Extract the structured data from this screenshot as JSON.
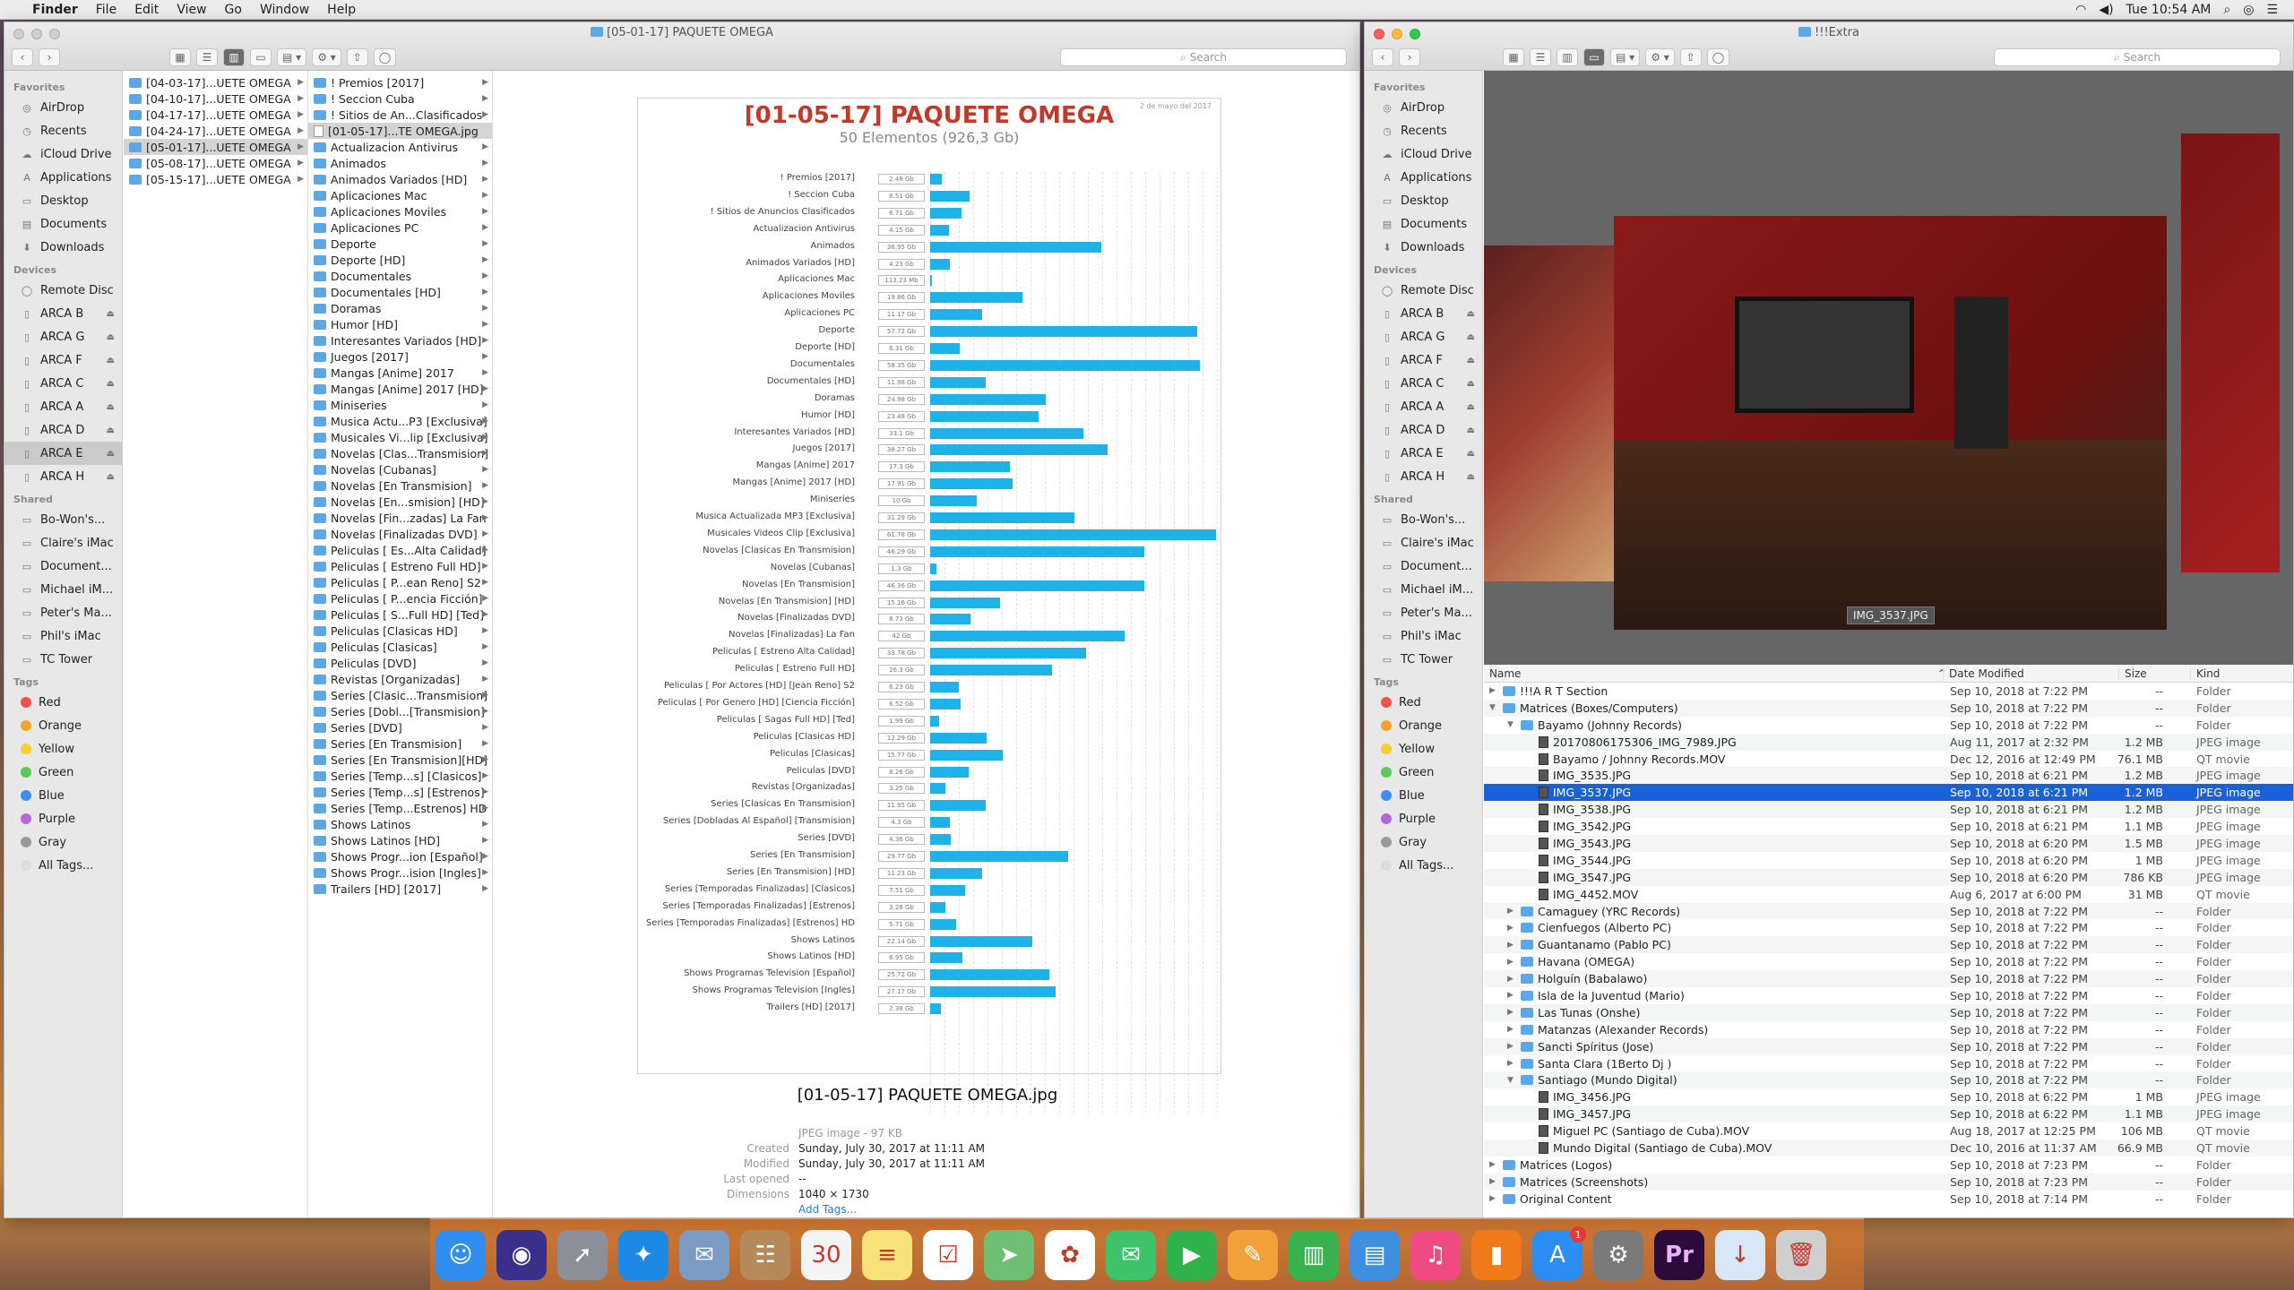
{
  "menubar": {
    "app": "Finder",
    "items": [
      "File",
      "Edit",
      "View",
      "Go",
      "Window",
      "Help"
    ],
    "clock": "Tue 10:54 AM"
  },
  "left_window": {
    "title": "[05-01-17] PAQUETE OMEGA",
    "search_placeholder": "Search",
    "sidebar": {
      "favorites_header": "Favorites",
      "favorites": [
        "AirDrop",
        "Recents",
        "iCloud Drive",
        "Applications",
        "Desktop",
        "Documents",
        "Downloads"
      ],
      "devices_header": "Devices",
      "devices": [
        "Remote Disc",
        "ARCA B",
        "ARCA G",
        "ARCA F",
        "ARCA C",
        "ARCA A",
        "ARCA D",
        "ARCA E",
        "ARCA H"
      ],
      "shared_header": "Shared",
      "shared": [
        "Bo-Won's...",
        "Claire's iMac",
        "Document...",
        "Michael iM...",
        "Peter's Ma...",
        "Phil's iMac",
        "TC Tower"
      ],
      "tags_header": "Tags",
      "tags": [
        {
          "name": "Red",
          "color": "#f4504a"
        },
        {
          "name": "Orange",
          "color": "#f6a32c"
        },
        {
          "name": "Yellow",
          "color": "#f6d02e"
        },
        {
          "name": "Green",
          "color": "#5ac85a"
        },
        {
          "name": "Blue",
          "color": "#3d8ef0"
        },
        {
          "name": "Purple",
          "color": "#b36ad8"
        },
        {
          "name": "Gray",
          "color": "#9a9a9a"
        },
        {
          "name": "All Tags...",
          "color": "#dddddd"
        }
      ]
    },
    "column1": [
      "[04-03-17]...UETE OMEGA",
      "[04-10-17]...UETE OMEGA",
      "[04-17-17]...UETE OMEGA",
      "[04-24-17]...UETE OMEGA",
      "[05-01-17]...UETE OMEGA",
      "[05-08-17]...UETE OMEGA",
      "[05-15-17]...UETE OMEGA"
    ],
    "column2": [
      "! Premios [2017]",
      "! Seccion Cuba",
      "! Sitios de An...Clasificados",
      "[01-05-17]...TE OMEGA.jpg",
      "Actualizacion Antivirus",
      "Animados",
      "Animados Variados [HD]",
      "Aplicaciones Mac",
      "Aplicaciones Moviles",
      "Aplicaciones PC",
      "Deporte",
      "Deporte [HD]",
      "Documentales",
      "Documentales [HD]",
      "Doramas",
      "Humor [HD]",
      "Interesantes Variados [HD]",
      "Juegos [2017]",
      "Mangas [Anime] 2017",
      "Mangas [Anime] 2017 [HD]",
      "Miniseries",
      "Musica Actu...P3 [Exclusiva]",
      "Musicales Vi...lip [Exclusiva]",
      "Novelas [Clas...Transmision]",
      "Novelas [Cubanas]",
      "Novelas [En Transmision]",
      "Novelas [En...smision] [HD]",
      "Novelas [Fin...zadas] La Fan",
      "Novelas [Finalizadas DVD]",
      "Peliculas [ Es...Alta Calidad]",
      "Peliculas [ Estreno Full HD]",
      "Peliculas [ P...ean Reno] S2",
      "Peliculas [ P...encia Ficción]",
      "Peliculas [ S...Full HD] [Ted]",
      "Peliculas [Clasicas HD]",
      "Peliculas [Clasicas]",
      "Peliculas [DVD]",
      "Revistas [Organizadas]",
      "Series [Clasic...Transmision]",
      "Series [Dobl...[Transmision]",
      "Series [DVD]",
      "Series [En Transmision]",
      "Series [En Transmision][HD]",
      "Series [Temp...s] [Clasicos]",
      "Series [Temp...s] [Estrenos]",
      "Series [Temp...Estrenos] HD",
      "Shows Latinos",
      "Shows Latinos [HD]",
      "Shows Progr...ion [Español]",
      "Shows Progr...ision [Ingles]",
      "Trailers [HD] [2017]"
    ],
    "column2_selected": 3,
    "preview": {
      "chart_title": "[01-05-17] PAQUETE OMEGA",
      "chart_subtitle": "50 Elementos (926,3 Gb)",
      "chart_date": "2 de mayo del 2017",
      "file_name": "[01-05-17] PAQUETE OMEGA.jpg",
      "kind": "JPEG image - 97 KB",
      "created_label": "Created",
      "created": "Sunday, July 30, 2017 at 11:11 AM",
      "modified_label": "Modified",
      "modified": "Sunday, July 30, 2017 at 11:11 AM",
      "opened_label": "Last opened",
      "opened": "--",
      "dim_label": "Dimensions",
      "dimensions": "1040 × 1730",
      "add_tags": "Add Tags..."
    }
  },
  "chart_data": {
    "type": "bar",
    "title": "[01-05-17] PAQUETE OMEGA",
    "subtitle": "50 Elementos (926,3 Gb)",
    "categories": [
      "! Premios [2017]",
      "! Seccion Cuba",
      "! Sitios de Anuncios Clasificados",
      "Actualizacion Antivirus",
      "Animados",
      "Animados Variados [HD]",
      "Aplicaciones Mac",
      "Aplicaciones Moviles",
      "Aplicaciones PC",
      "Deporte",
      "Deporte [HD]",
      "Documentales",
      "Documentales [HD]",
      "Doramas",
      "Humor [HD]",
      "Interesantes Variados [HD]",
      "Juegos [2017]",
      "Mangas [Anime] 2017",
      "Mangas [Anime] 2017 [HD]",
      "Miniseries",
      "Musica Actualizada MP3 [Exclusiva]",
      "Musicales Videos Clip [Exclusiva]",
      "Novelas [Clasicas En Transmision]",
      "Novelas [Cubanas]",
      "Novelas [En Transmision]",
      "Novelas [En Transmision] [HD]",
      "Novelas [Finalizadas DVD]",
      "Novelas [Finalizadas] La Fan",
      "Peliculas [ Estreno Alta Calidad]",
      "Peliculas [ Estreno Full HD]",
      "Peliculas [ Por Actores [HD] [Jean Reno] S2",
      "Peliculas [ Por Genero [HD] [Ciencia Ficción]",
      "Peliculas [ Sagas Full HD] [Ted]",
      "Peliculas [Clasicas HD]",
      "Peliculas [Clasicas]",
      "Peliculas [DVD]",
      "Revistas [Organizadas]",
      "Series [Clasicas En Transmision]",
      "Series [Dobladas Al Español] [Transmision]",
      "Series [DVD]",
      "Series [En Transmision]",
      "Series [En Transmision] [HD]",
      "Series [Temporadas Finalizadas] [Clasicos]",
      "Series [Temporadas Finalizadas] [Estrenos]",
      "Series [Temporadas Finalizadas] [Estrenos] HD",
      "Shows Latinos",
      "Shows Latinos [HD]",
      "Shows Programas Television [Español]",
      "Shows Programas Television [Ingles]",
      "Trailers [HD] [2017]"
    ],
    "values": [
      2.48,
      8.51,
      6.71,
      4.15,
      36.95,
      4.23,
      0.113,
      19.86,
      11.17,
      57.72,
      6.31,
      58.35,
      11.98,
      24.98,
      23.48,
      33.1,
      38.27,
      17.3,
      17.91,
      10,
      31.29,
      61.78,
      46.29,
      1.3,
      46.36,
      15.16,
      8.73,
      42,
      33.78,
      26.3,
      6.23,
      6.52,
      1.99,
      12.29,
      15.77,
      8.26,
      3.25,
      11.95,
      4.3,
      4.36,
      29.77,
      11.23,
      7.51,
      3.28,
      5.71,
      22.14,
      6.95,
      25.72,
      27.17,
      2.38
    ],
    "value_labels": [
      "2.48 Gb",
      "8.51 Gb",
      "6.71 Gb",
      "4.15 Gb",
      "36.95 Gb",
      "4.23 Gb",
      "113.23 Mb",
      "19.86 Gb",
      "11.17 Gb",
      "57.72 Gb",
      "6.31 Gb",
      "58.35 Gb",
      "11.98 Gb",
      "24.98 Gb",
      "23.48 Gb",
      "33.1 Gb",
      "38.27 Gb",
      "17.3 Gb",
      "17.91 Gb",
      "10 Gb",
      "31.29 Gb",
      "61.78 Gb",
      "46.29 Gb",
      "1.3 Gb",
      "46.36 Gb",
      "15.16 Gb",
      "8.73 Gb",
      "42 Gb",
      "33.78 Gb",
      "26.3 Gb",
      "6.23 Gb",
      "6.52 Gb",
      "1.99 Gb",
      "12.29 Gb",
      "15.77 Gb",
      "8.26 Gb",
      "3.25 Gb",
      "11.95 Gb",
      "4.3 Gb",
      "4.36 Gb",
      "29.77 Gb",
      "11.23 Gb",
      "7.51 Gb",
      "3.28 Gb",
      "5.71 Gb",
      "22.14 Gb",
      "6.95 Gb",
      "25.72 Gb",
      "27.17 Gb",
      "2.38 Gb"
    ],
    "xlim": [
      0,
      62
    ],
    "bar_color": "#1eb2e8",
    "grid": true
  },
  "right_window": {
    "title": "!!!Extra",
    "search_placeholder": "Search",
    "caption": "IMG_3537.JPG",
    "columns": {
      "name": "Name",
      "date": "Date Modified",
      "size": "Size",
      "kind": "Kind"
    },
    "rows": [
      {
        "indent": 0,
        "disc": "▶",
        "type": "folder",
        "name": "!!!A R T Section",
        "date": "Sep 10, 2018 at 7:22 PM",
        "size": "--",
        "kind": "Folder"
      },
      {
        "indent": 0,
        "disc": "▼",
        "type": "folder",
        "name": "Matrices (Boxes/Computers)",
        "date": "Sep 10, 2018 at 7:22 PM",
        "size": "--",
        "kind": "Folder"
      },
      {
        "indent": 1,
        "disc": "▼",
        "type": "folder",
        "name": "Bayamo (Johnny Records)",
        "date": "Sep 10, 2018 at 7:22 PM",
        "size": "--",
        "kind": "Folder"
      },
      {
        "indent": 2,
        "disc": "",
        "type": "file",
        "name": "20170806175306_IMG_7989.JPG",
        "date": "Aug 11, 2017 at 2:32 PM",
        "size": "1.2 MB",
        "kind": "JPEG image"
      },
      {
        "indent": 2,
        "disc": "",
        "type": "file",
        "name": "Bayamo / Johnny Records.MOV",
        "date": "Dec 12, 2016 at 12:49 PM",
        "size": "76.1 MB",
        "kind": "QT movie"
      },
      {
        "indent": 2,
        "disc": "",
        "type": "file",
        "name": "IMG_3535.JPG",
        "date": "Sep 10, 2018 at 6:21 PM",
        "size": "1.2 MB",
        "kind": "JPEG image"
      },
      {
        "indent": 2,
        "disc": "",
        "type": "file",
        "name": "IMG_3537.JPG",
        "date": "Sep 10, 2018 at 6:21 PM",
        "size": "1.2 MB",
        "kind": "JPEG image",
        "selected": true
      },
      {
        "indent": 2,
        "disc": "",
        "type": "file",
        "name": "IMG_3538.JPG",
        "date": "Sep 10, 2018 at 6:21 PM",
        "size": "1.2 MB",
        "kind": "JPEG image"
      },
      {
        "indent": 2,
        "disc": "",
        "type": "file",
        "name": "IMG_3542.JPG",
        "date": "Sep 10, 2018 at 6:21 PM",
        "size": "1.1 MB",
        "kind": "JPEG image"
      },
      {
        "indent": 2,
        "disc": "",
        "type": "file",
        "name": "IMG_3543.JPG",
        "date": "Sep 10, 2018 at 6:20 PM",
        "size": "1.5 MB",
        "kind": "JPEG image"
      },
      {
        "indent": 2,
        "disc": "",
        "type": "file",
        "name": "IMG_3544.JPG",
        "date": "Sep 10, 2018 at 6:20 PM",
        "size": "1 MB",
        "kind": "JPEG image"
      },
      {
        "indent": 2,
        "disc": "",
        "type": "file",
        "name": "IMG_3547.JPG",
        "date": "Sep 10, 2018 at 6:20 PM",
        "size": "786 KB",
        "kind": "JPEG image"
      },
      {
        "indent": 2,
        "disc": "",
        "type": "file",
        "name": "IMG_4452.MOV",
        "date": "Aug 6, 2017 at 6:00 PM",
        "size": "31 MB",
        "kind": "QT movie"
      },
      {
        "indent": 1,
        "disc": "▶",
        "type": "folder",
        "name": "Camaguey (YRC Records)",
        "date": "Sep 10, 2018 at 7:22 PM",
        "size": "--",
        "kind": "Folder"
      },
      {
        "indent": 1,
        "disc": "▶",
        "type": "folder",
        "name": "Cienfuegos (Alberto PC)",
        "date": "Sep 10, 2018 at 7:22 PM",
        "size": "--",
        "kind": "Folder"
      },
      {
        "indent": 1,
        "disc": "▶",
        "type": "folder",
        "name": "Guantanamo (Pablo PC)",
        "date": "Sep 10, 2018 at 7:22 PM",
        "size": "--",
        "kind": "Folder"
      },
      {
        "indent": 1,
        "disc": "▶",
        "type": "folder",
        "name": "Havana (OMEGA)",
        "date": "Sep 10, 2018 at 7:22 PM",
        "size": "--",
        "kind": "Folder"
      },
      {
        "indent": 1,
        "disc": "▶",
        "type": "folder",
        "name": "Holguín (Babalawo)",
        "date": "Sep 10, 2018 at 7:22 PM",
        "size": "--",
        "kind": "Folder"
      },
      {
        "indent": 1,
        "disc": "▶",
        "type": "folder",
        "name": "Isla de la Juventud (Mario)",
        "date": "Sep 10, 2018 at 7:22 PM",
        "size": "--",
        "kind": "Folder"
      },
      {
        "indent": 1,
        "disc": "▶",
        "type": "folder",
        "name": "Las Tunas (Onshe)",
        "date": "Sep 10, 2018 at 7:22 PM",
        "size": "--",
        "kind": "Folder"
      },
      {
        "indent": 1,
        "disc": "▶",
        "type": "folder",
        "name": "Matanzas (Alexander Records)",
        "date": "Sep 10, 2018 at 7:22 PM",
        "size": "--",
        "kind": "Folder"
      },
      {
        "indent": 1,
        "disc": "▶",
        "type": "folder",
        "name": "Sancti Spíritus (Jose)",
        "date": "Sep 10, 2018 at 7:22 PM",
        "size": "--",
        "kind": "Folder"
      },
      {
        "indent": 1,
        "disc": "▶",
        "type": "folder",
        "name": "Santa Clara (1Berto Dj )",
        "date": "Sep 10, 2018 at 7:22 PM",
        "size": "--",
        "kind": "Folder"
      },
      {
        "indent": 1,
        "disc": "▼",
        "type": "folder",
        "name": "Santiago (Mundo Digital)",
        "date": "Sep 10, 2018 at 7:22 PM",
        "size": "--",
        "kind": "Folder"
      },
      {
        "indent": 2,
        "disc": "",
        "type": "file",
        "name": "IMG_3456.JPG",
        "date": "Sep 10, 2018 at 6:22 PM",
        "size": "1 MB",
        "kind": "JPEG image"
      },
      {
        "indent": 2,
        "disc": "",
        "type": "file",
        "name": "IMG_3457.JPG",
        "date": "Sep 10, 2018 at 6:22 PM",
        "size": "1.1 MB",
        "kind": "JPEG image"
      },
      {
        "indent": 2,
        "disc": "",
        "type": "file",
        "name": "Miguel PC (Santiago de Cuba).MOV",
        "date": "Aug 18, 2017 at 12:25 PM",
        "size": "106 MB",
        "kind": "QT movie"
      },
      {
        "indent": 2,
        "disc": "",
        "type": "file",
        "name": "Mundo Digital (Santiago de Cuba).MOV",
        "date": "Dec 10, 2016 at 11:37 AM",
        "size": "66.9 MB",
        "kind": "QT movie"
      },
      {
        "indent": 0,
        "disc": "▶",
        "type": "folder",
        "name": "Matrices (Logos)",
        "date": "Sep 10, 2018 at 7:23 PM",
        "size": "--",
        "kind": "Folder"
      },
      {
        "indent": 0,
        "disc": "▶",
        "type": "folder",
        "name": "Matrices (Screenshots)",
        "date": "Sep 10, 2018 at 7:23 PM",
        "size": "--",
        "kind": "Folder"
      },
      {
        "indent": 0,
        "disc": "▶",
        "type": "folder",
        "name": "Original Content",
        "date": "Sep 10, 2018 at 7:14 PM",
        "size": "--",
        "kind": "Folder"
      }
    ]
  },
  "dock": {
    "items": [
      {
        "name": "finder",
        "color": "#2f8ef0",
        "glyph": "☺"
      },
      {
        "name": "siri",
        "color": "#3a2f8a",
        "glyph": "◉"
      },
      {
        "name": "launchpad",
        "color": "#8a8f99",
        "glyph": "➚"
      },
      {
        "name": "safari",
        "color": "#1e88e5",
        "glyph": "✦"
      },
      {
        "name": "mail-stamp",
        "color": "#7a9bc2",
        "glyph": "✉"
      },
      {
        "name": "contacts",
        "color": "#b58a5a",
        "glyph": "☷"
      },
      {
        "name": "calendar",
        "color": "#f4f4f4",
        "glyph": "30"
      },
      {
        "name": "notes",
        "color": "#f7e27a",
        "glyph": "≡"
      },
      {
        "name": "reminders",
        "color": "#ffffff",
        "glyph": "☑"
      },
      {
        "name": "maps",
        "color": "#6fbf73",
        "glyph": "➤"
      },
      {
        "name": "photos",
        "color": "#ffffff",
        "glyph": "✿"
      },
      {
        "name": "messages",
        "color": "#3ec26a",
        "glyph": "✉"
      },
      {
        "name": "facetime",
        "color": "#2fb24c",
        "glyph": "▶"
      },
      {
        "name": "pages",
        "color": "#f2a03a",
        "glyph": "✎"
      },
      {
        "name": "numbers",
        "color": "#37b24d",
        "glyph": "▥"
      },
      {
        "name": "keynote",
        "color": "#3f8fe0",
        "glyph": "▤"
      },
      {
        "name": "itunes",
        "color": "#f04a82",
        "glyph": "♫"
      },
      {
        "name": "ibooks",
        "color": "#f07a1a",
        "glyph": "▮"
      },
      {
        "name": "app-store",
        "color": "#2b8ef0",
        "glyph": "A",
        "badge": "1"
      },
      {
        "name": "system-preferences",
        "color": "#7a7a7a",
        "glyph": "⚙"
      },
      {
        "name": "premiere",
        "color": "#2a0b3a",
        "glyph": "Pr"
      },
      {
        "name": "downloads",
        "color": "#d8e6f5",
        "glyph": "↓"
      },
      {
        "name": "trash",
        "color": "#cfcfcf",
        "glyph": "🗑"
      }
    ]
  }
}
